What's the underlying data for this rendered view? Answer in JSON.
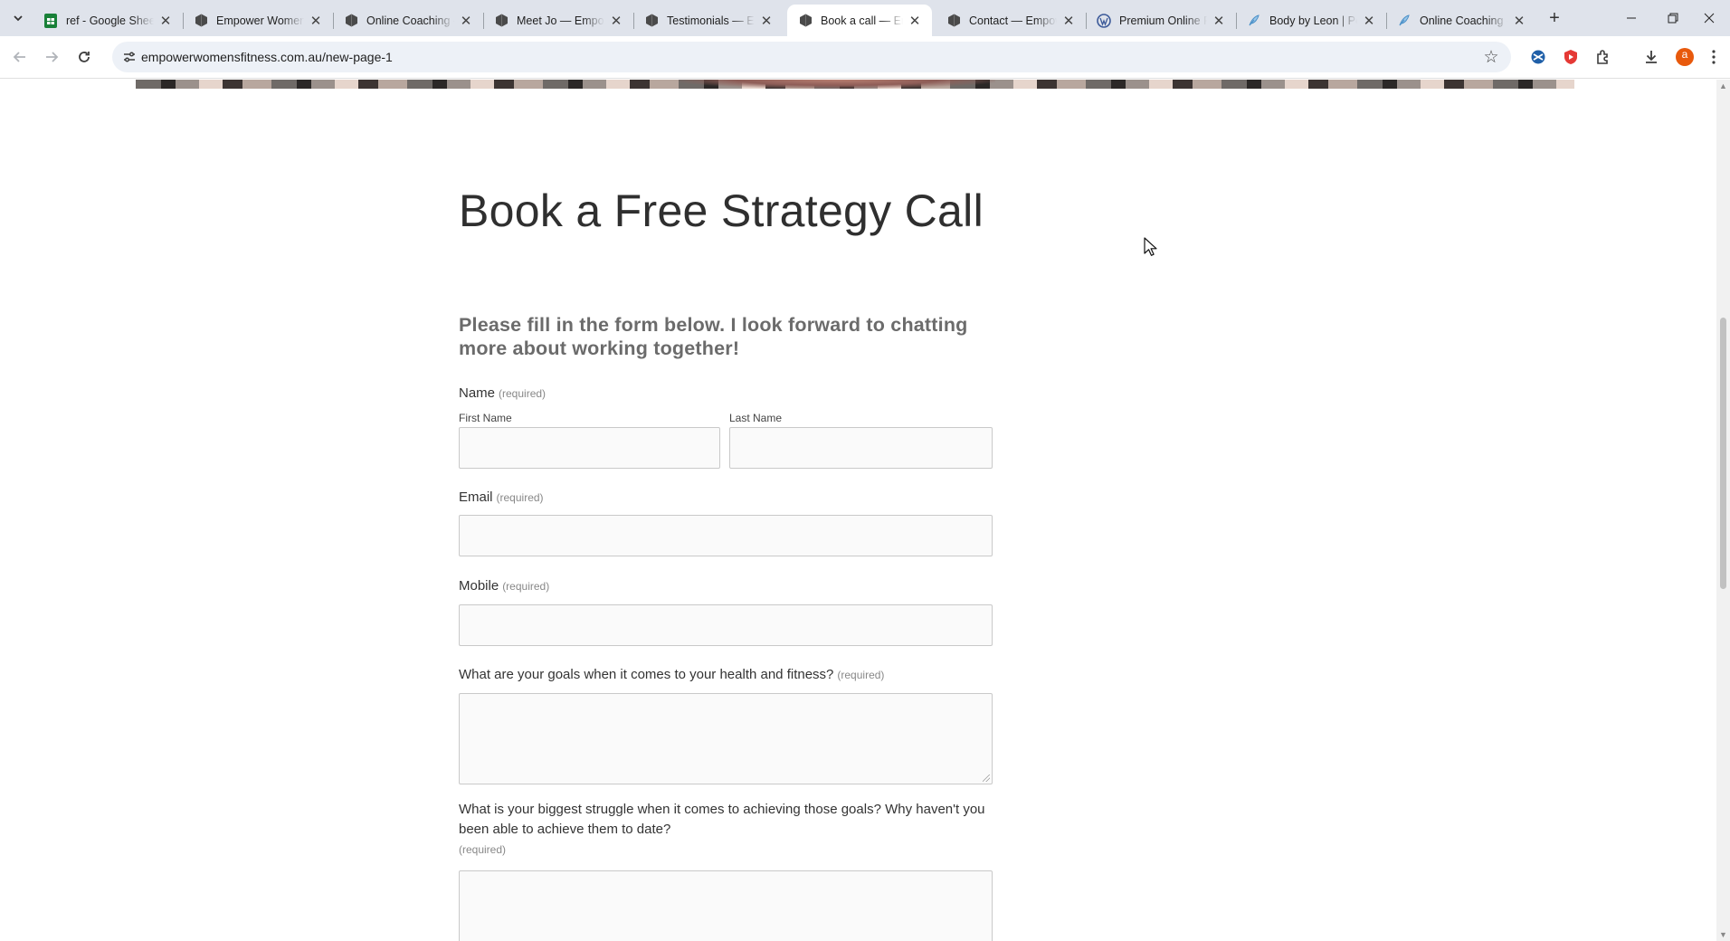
{
  "browser": {
    "tabs": [
      {
        "title": "ref - Google Sheets",
        "icon": "sheets-icon",
        "active": false
      },
      {
        "title": "Empower Women's Fitness",
        "icon": "squarespace-icon",
        "active": false
      },
      {
        "title": "Online Coaching — Empower",
        "icon": "squarespace-icon",
        "active": false
      },
      {
        "title": "Meet Jo — Empower",
        "icon": "squarespace-icon",
        "active": false
      },
      {
        "title": "Testimonials — Empower",
        "icon": "squarespace-icon",
        "active": false
      },
      {
        "title": "Book a call — Empower",
        "icon": "squarespace-icon",
        "active": true
      },
      {
        "title": "Contact — Empower",
        "icon": "squarespace-icon",
        "active": false
      },
      {
        "title": "Premium Online Personal",
        "icon": "wordpress-icon",
        "active": false
      },
      {
        "title": "Body by Leon | Personal",
        "icon": "feather-icon",
        "active": false
      },
      {
        "title": "Online Coaching - Body",
        "icon": "feather-icon",
        "active": false
      }
    ],
    "url": "empowerwomensfitness.com.au/new-page-1",
    "profile_initial": "a",
    "accent": "#1a73e8"
  },
  "page": {
    "heading": "Book a Free Strategy Call",
    "intro": "Please fill in the form below.  I look forward to chatting more about working together!",
    "form": {
      "required_label": "(required)",
      "name": {
        "label": "Name",
        "first_label": "First Name",
        "last_label": "Last Name",
        "first_value": "",
        "last_value": ""
      },
      "email": {
        "label": "Email",
        "value": ""
      },
      "mobile": {
        "label": "Mobile",
        "value": ""
      },
      "goals": {
        "label": "What are your goals when it comes to your health and fitness?",
        "value": ""
      },
      "struggle": {
        "label": "What is your biggest struggle when it comes to achieving those goals? Why haven't you been able to achieve them to date?",
        "value": ""
      }
    }
  }
}
